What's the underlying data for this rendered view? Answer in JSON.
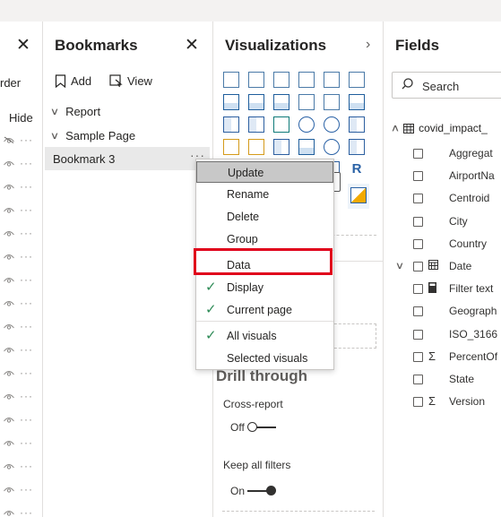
{
  "selection_pane": {
    "close": "✕",
    "order_label": "rder",
    "hide_label": "Hide",
    "more": "···"
  },
  "bookmarks": {
    "title": "Bookmarks",
    "close": "✕",
    "add_label": "Add",
    "view_label": "View",
    "items": [
      {
        "label": "Report"
      },
      {
        "label": "Sample Page"
      }
    ],
    "selected": {
      "label": "Bookmark 3",
      "more": "···"
    }
  },
  "context_menu": {
    "items": [
      {
        "label": "Update",
        "checked": false
      },
      {
        "label": "Rename",
        "checked": false
      },
      {
        "label": "Delete",
        "checked": false
      },
      {
        "label": "Group",
        "checked": false
      },
      {
        "label": "Data",
        "checked": false
      },
      {
        "label": "Display",
        "checked": true
      },
      {
        "label": "Current page",
        "checked": true
      },
      {
        "label": "All visuals",
        "checked": true
      },
      {
        "label": "Selected visuals",
        "checked": false
      }
    ]
  },
  "visualizations": {
    "title": "Visualizations",
    "expand": "›",
    "r_icon": "R",
    "drill_through": "Drill through",
    "cross_report": {
      "label": "Cross-report",
      "state": "Off"
    },
    "keep_all_filters": {
      "label": "Keep all filters",
      "state": "On"
    }
  },
  "fields": {
    "title": "Fields",
    "search_placeholder": "Search",
    "table_name": "covid_impact_",
    "items": [
      {
        "name": "Aggregat",
        "icon": ""
      },
      {
        "name": "AirportNa",
        "icon": ""
      },
      {
        "name": "Centroid",
        "icon": ""
      },
      {
        "name": "City",
        "icon": ""
      },
      {
        "name": "Country",
        "icon": ""
      },
      {
        "name": "Date",
        "icon": "calendar-icon"
      },
      {
        "name": "Filter text",
        "icon": "calculator-icon"
      },
      {
        "name": "Geograph",
        "icon": ""
      },
      {
        "name": "ISO_3166",
        "icon": ""
      },
      {
        "name": "PercentOf",
        "icon": "sigma-icon",
        "glyph": "Σ"
      },
      {
        "name": "State",
        "icon": ""
      },
      {
        "name": "Version",
        "icon": "sigma-icon",
        "glyph": "Σ"
      }
    ]
  }
}
